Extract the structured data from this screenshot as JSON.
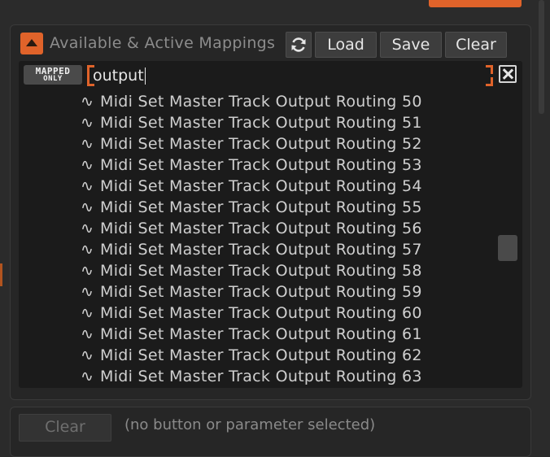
{
  "panel": {
    "title": "Available & Active Mappings",
    "load_label": "Load",
    "save_label": "Save",
    "clear_label": "Clear"
  },
  "filter": {
    "mapped_only_line1": "MAPPED",
    "mapped_only_line2": "ONLY",
    "search_value": "output"
  },
  "list": {
    "item_glyph": "∿",
    "items": [
      "Midi Set Master Track Output Routing 50",
      "Midi Set Master Track Output Routing 51",
      "Midi Set Master Track Output Routing 52",
      "Midi Set Master Track Output Routing 53",
      "Midi Set Master Track Output Routing 54",
      "Midi Set Master Track Output Routing 55",
      "Midi Set Master Track Output Routing 56",
      "Midi Set Master Track Output Routing 57",
      "Midi Set Master Track Output Routing 58",
      "Midi Set Master Track Output Routing 59",
      "Midi Set Master Track Output Routing 60",
      "Midi Set Master Track Output Routing 61",
      "Midi Set Master Track Output Routing 62",
      "Midi Set Master Track Output Routing 63"
    ]
  },
  "bottom": {
    "clear_label": "Clear",
    "status": "(no button or parameter selected)"
  },
  "colors": {
    "accent": "#e0632a",
    "background": "#2b2b2b",
    "list_background": "#1b1b1b"
  },
  "icons": {
    "collapse": "triangle-up-icon",
    "refresh": "refresh-icon",
    "clear_search": "close-icon",
    "item": "wave-icon"
  }
}
